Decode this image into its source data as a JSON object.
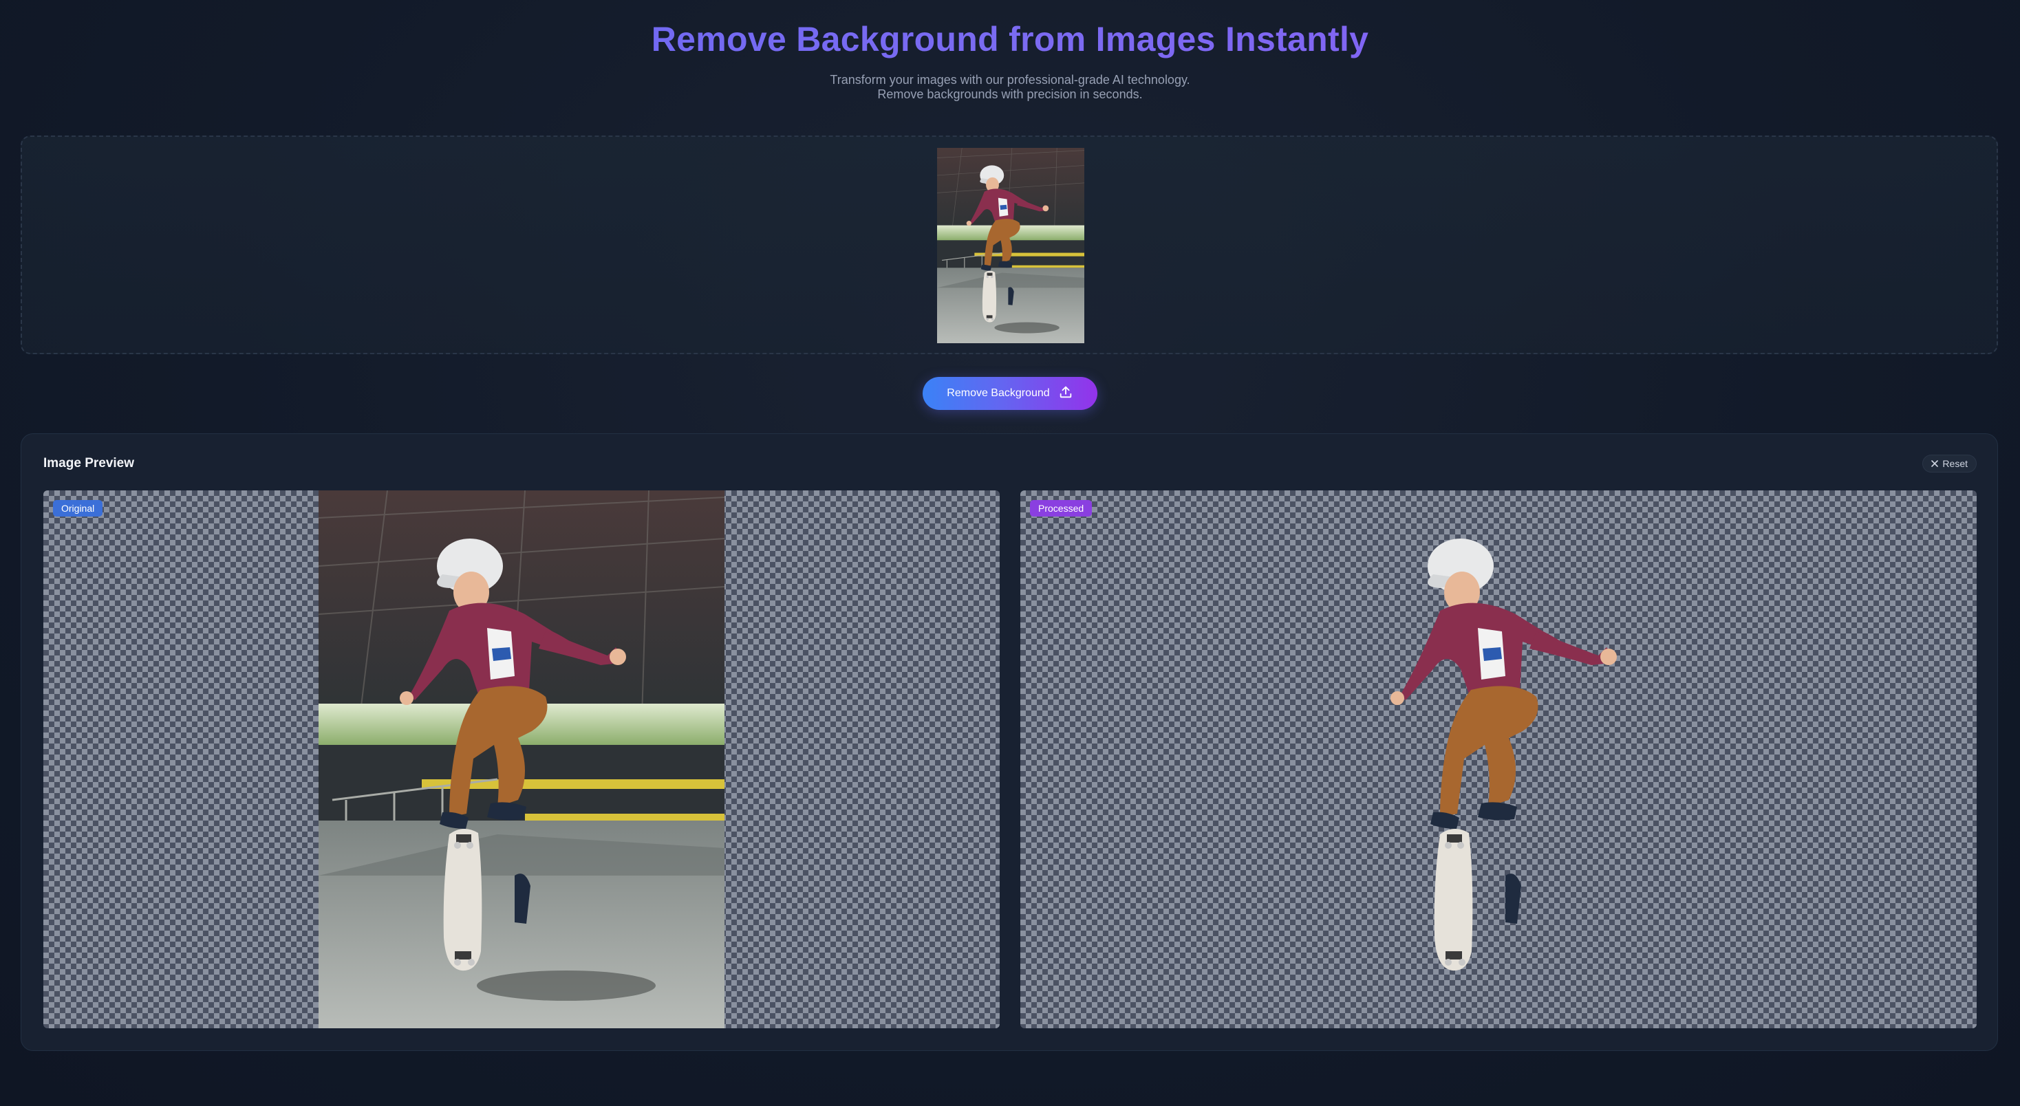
{
  "header": {
    "title": "Remove Background from Images Instantly",
    "subtitle_line1": "Transform your images with our professional-grade AI technology.",
    "subtitle_line2": "Remove backgrounds with precision in seconds."
  },
  "upload": {
    "thumbnail_alt": "Skateboarder mid-air kickflip in indoor skatepark"
  },
  "action": {
    "remove_label": "Remove Background",
    "icon": "upload-icon"
  },
  "preview": {
    "title": "Image Preview",
    "reset_label": "Reset",
    "original_badge": "Original",
    "processed_badge": "Processed"
  },
  "colors": {
    "accent_start": "#3b82f6",
    "accent_mid": "#6366f1",
    "accent_end": "#9333ea",
    "title_gradient_start": "#6366f1",
    "title_gradient_end": "#8b5cf6",
    "background": "#121a29",
    "card": "#182131"
  }
}
